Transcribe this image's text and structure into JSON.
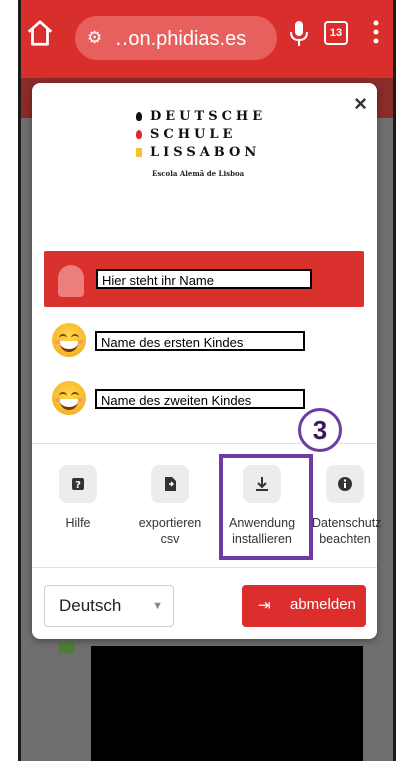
{
  "browser": {
    "url": "‥on.phidias.es",
    "url_icon": "tune-icon",
    "tab_count": "13"
  },
  "modal": {
    "close_label": "×",
    "logo": {
      "line1": "DEUTSCHE",
      "line2": "SCHULE",
      "line3": "LISSABON",
      "subtitle": "Escola Alemã de Lisboa",
      "colors": [
        "#111111",
        "#d82e2c",
        "#f2c231"
      ]
    },
    "people": {
      "parent_name": "Hier steht ihr Name",
      "child1_name": "Name des ersten Kindes",
      "child2_name": "Name des zweiten Kindes"
    },
    "actions": {
      "help": {
        "label": "Hilfe",
        "icon": "question-icon"
      },
      "export": {
        "label1": "exportieren",
        "label2": "csv",
        "icon": "file-export-icon"
      },
      "install": {
        "label1": "Anwendung",
        "label2": "installieren",
        "icon": "download-icon"
      },
      "privacy": {
        "label1": "Datenschutz",
        "label2": "beachten",
        "icon": "info-icon"
      }
    },
    "step_badge": "3",
    "language": {
      "selected": "Deutsch"
    },
    "logout": {
      "label": "abmelden",
      "icon": "logout-icon"
    }
  },
  "colors": {
    "brand_red": "#d82e2c",
    "highlight_purple": "#6f3ba3"
  }
}
